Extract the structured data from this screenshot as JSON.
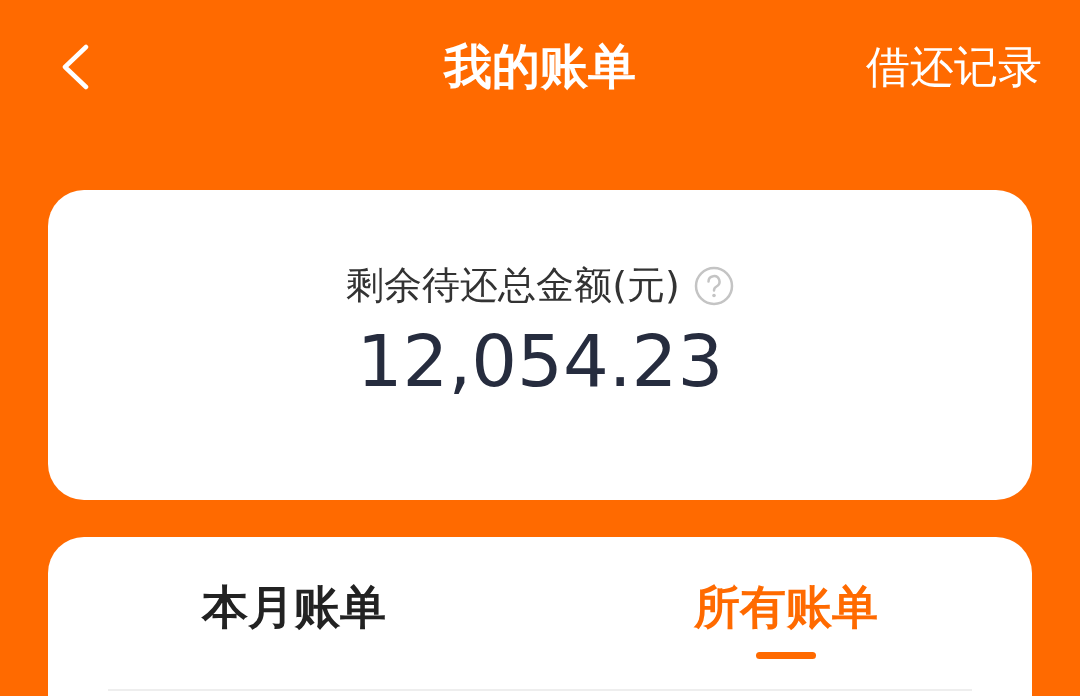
{
  "header": {
    "title": "我的账单",
    "action": "借还记录"
  },
  "summary": {
    "label": "剩余待还总金额(元)",
    "amount": "12,054.23"
  },
  "tabs": [
    {
      "label": "本月账单",
      "selected": false
    },
    {
      "label": "所有账单",
      "selected": true
    }
  ]
}
